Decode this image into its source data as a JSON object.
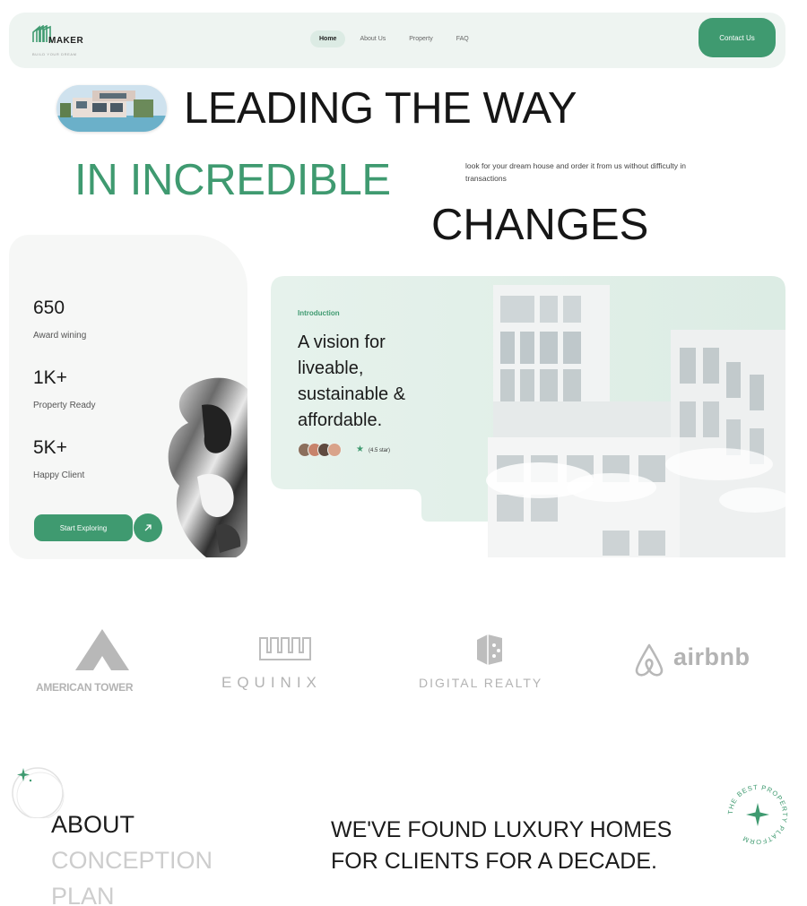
{
  "brand": {
    "name": "MAKER",
    "tagline": "BUILD YOUR DREAM"
  },
  "nav": {
    "items": [
      "Home",
      "About Us",
      "Property",
      "FAQ"
    ],
    "active": "Home",
    "contact_label": "Contact Us"
  },
  "hero": {
    "line1": "LEADING THE WAY",
    "line2": "IN INCREDIBLE",
    "line3": "CHANGES",
    "description": "look for your dream house and order it from us without difficulty in transactions"
  },
  "stats": [
    {
      "value": "650",
      "label": "Award wining"
    },
    {
      "value": "1K+",
      "label": "Property Ready"
    },
    {
      "value": "5K+",
      "label": "Happy Client"
    }
  ],
  "explore_label": "Start Exploring",
  "arrow_icon": "arrow-up-right-icon",
  "intro": {
    "label": "Introduction",
    "title": "A vision for liveable, sustainable & affordable.",
    "rating": "(4.5 star)",
    "avatar_colors": [
      "#8b6f5c",
      "#c7836b",
      "#5f4a3f",
      "#d9a38a"
    ]
  },
  "partners": [
    {
      "name": "AMERICAN TOWER",
      "icon": "tower-logo-icon"
    },
    {
      "name": "EQUINIX",
      "icon": "equinix-logo-icon"
    },
    {
      "name": "DIGITAL REALTY",
      "icon": "digital-realty-logo-icon"
    },
    {
      "name": "airbnb",
      "icon": "airbnb-logo-icon"
    }
  ],
  "about": {
    "tabs": [
      "ABOUT",
      "CONCEPTION",
      "PLAN"
    ],
    "active_tab": "ABOUT",
    "statement": "WE'VE FOUND LUXURY HOMES FOR CLIENTS FOR A DECADE.",
    "badge_text": "THE BEST PROPERTY PLATFORM"
  },
  "colors": {
    "accent": "#3f9a70",
    "nav_bg": "#eef4f1",
    "muted_text": "#cdcdcd",
    "logo_gray": "#b3b3b3"
  }
}
